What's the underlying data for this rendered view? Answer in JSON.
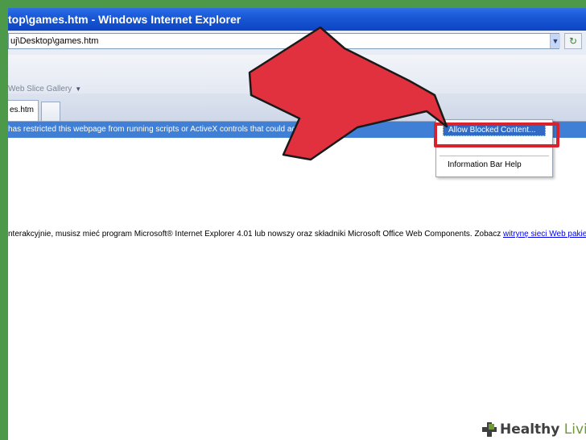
{
  "window": {
    "title": "top\\games.htm - Windows Internet Explorer"
  },
  "address": {
    "value": "uj\\Desktop\\games.htm"
  },
  "favorites": {
    "web_slice_gallery": "Web Slice Gallery"
  },
  "tabs": [
    {
      "label": "es.htm",
      "active": true
    }
  ],
  "infobar": {
    "text": "has restricted this webpage from running scripts or ActiveX controls that could access your co"
  },
  "context_menu": {
    "items": [
      {
        "label": "Allow Blocked Content...",
        "highlighted": true
      },
      {
        "label": "Information Bar Help",
        "highlighted": false
      }
    ]
  },
  "body": {
    "text": "nterakcyjnie, musisz mieć program Microsoft® Internet Explorer 4.01 lub nowszy oraz składniki Microsoft Office Web Components. Zobacz ",
    "link": "witrynę sieci Web pakietu Microsoft Of"
  },
  "watermark": {
    "brand_bold": "Healthy",
    "brand_rest": " Living"
  },
  "colors": {
    "frame_green": "#4b9949",
    "titlebar_blue": "#0c45c4",
    "infobar_blue": "#3f7fd6",
    "menu_highlight": "#316ac5",
    "annotation_red": "#d8232e"
  },
  "icons": {
    "address_dropdown": "chevron-down-icon",
    "refresh": "refresh-icon",
    "web_slice_caret": "caret-down-icon",
    "watermark_logo": "healthy-living-cross-icon"
  }
}
